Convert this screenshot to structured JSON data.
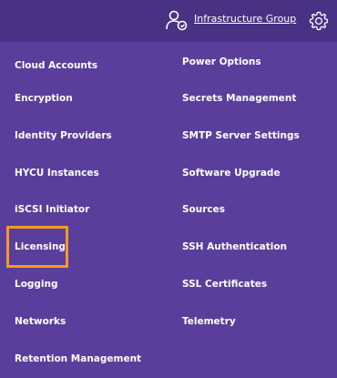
{
  "header": {
    "group_icon": "user-group-icon",
    "group_label": "Infrastructure Group",
    "settings_icon": "gear-icon"
  },
  "menu": {
    "left_column": [
      "Cloud Accounts",
      "Encryption",
      "Identity Providers",
      "HYCU Instances",
      "iSCSI Initiator",
      "Licensing",
      "Logging",
      "Networks",
      "Retention Management"
    ],
    "right_column": [
      "Power Options",
      "Secrets Management",
      "SMTP Server Settings",
      "Software Upgrade",
      "Sources",
      "SSH Authentication",
      "SSL Certificates",
      "Telemetry"
    ]
  },
  "colors": {
    "header_bg": "#493184",
    "panel_bg": "#5a3e9c",
    "highlight": "#f59a23",
    "text": "#ffffff"
  }
}
